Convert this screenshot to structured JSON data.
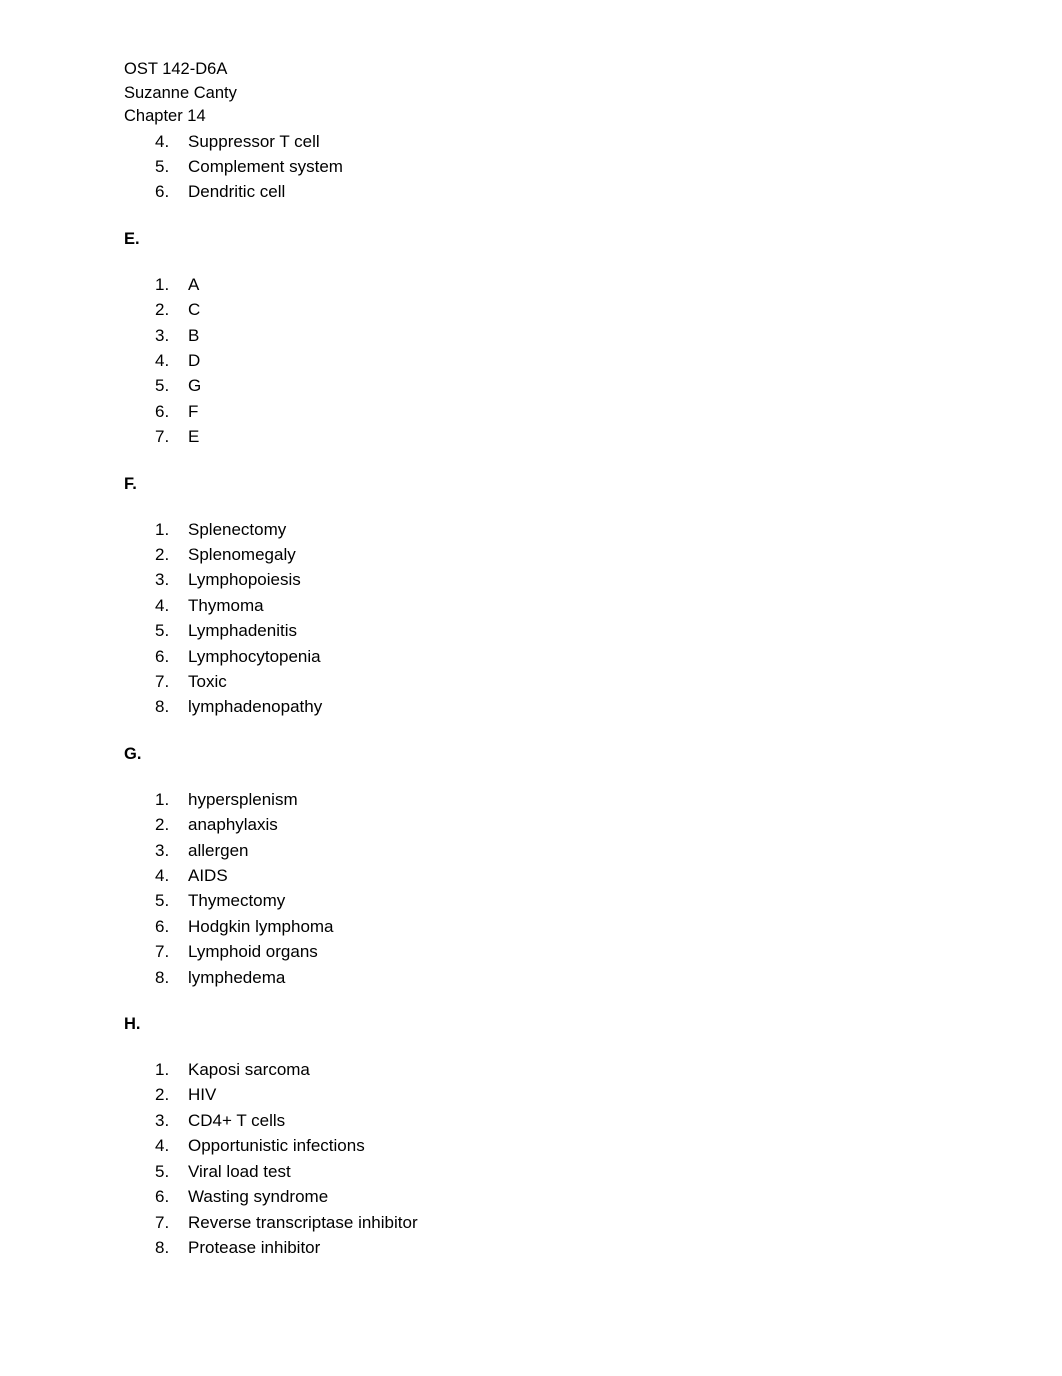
{
  "document": {
    "header_lines": [
      "OST 142-D6A",
      "Suzanne Canty",
      "Chapter 14"
    ],
    "top_list": {
      "items": [
        {
          "number": "4.",
          "text": "Suppressor T cell"
        },
        {
          "number": "5.",
          "text": "Complement system"
        },
        {
          "number": "6.",
          "text": "Dendritic cell"
        }
      ]
    },
    "sections": [
      {
        "heading": "E.",
        "items": [
          {
            "number": "1.",
            "text": "A"
          },
          {
            "number": "2.",
            "text": "C"
          },
          {
            "number": "3.",
            "text": "B"
          },
          {
            "number": "4.",
            "text": "D"
          },
          {
            "number": "5.",
            "text": "G"
          },
          {
            "number": "6.",
            "text": "F"
          },
          {
            "number": "7.",
            "text": "E"
          }
        ]
      },
      {
        "heading": "F.",
        "items": [
          {
            "number": "1.",
            "text": "Splenectomy"
          },
          {
            "number": "2.",
            "text": "Splenomegaly"
          },
          {
            "number": "3.",
            "text": "Lymphopoiesis"
          },
          {
            "number": "4.",
            "text": "Thymoma"
          },
          {
            "number": "5.",
            "text": "Lymphadenitis"
          },
          {
            "number": "6.",
            "text": "Lymphocytopenia"
          },
          {
            "number": "7.",
            "text": "Toxic"
          },
          {
            "number": "8.",
            "text": "lymphadenopathy"
          }
        ]
      },
      {
        "heading": "G.",
        "items": [
          {
            "number": "1.",
            "text": "hypersplenism"
          },
          {
            "number": "2.",
            "text": "anaphylaxis"
          },
          {
            "number": "3.",
            "text": "allergen"
          },
          {
            "number": "4.",
            "text": "AIDS"
          },
          {
            "number": "5.",
            "text": "Thymectomy"
          },
          {
            "number": "6.",
            "text": "Hodgkin lymphoma"
          },
          {
            "number": "7.",
            "text": "Lymphoid organs"
          },
          {
            "number": "8.",
            "text": "lymphedema"
          }
        ]
      },
      {
        "heading": "H.",
        "items": [
          {
            "number": "1.",
            "text": "Kaposi sarcoma"
          },
          {
            "number": "2.",
            "text": "HIV"
          },
          {
            "number": "3.",
            "text": "CD4+ T cells"
          },
          {
            "number": "4.",
            "text": "Opportunistic infections"
          },
          {
            "number": "5.",
            "text": "Viral load test"
          },
          {
            "number": "6.",
            "text": "Wasting syndrome"
          },
          {
            "number": "7.",
            "text": "Reverse transcriptase inhibitor"
          },
          {
            "number": "8.",
            "text": "Protease inhibitor"
          }
        ]
      }
    ]
  }
}
